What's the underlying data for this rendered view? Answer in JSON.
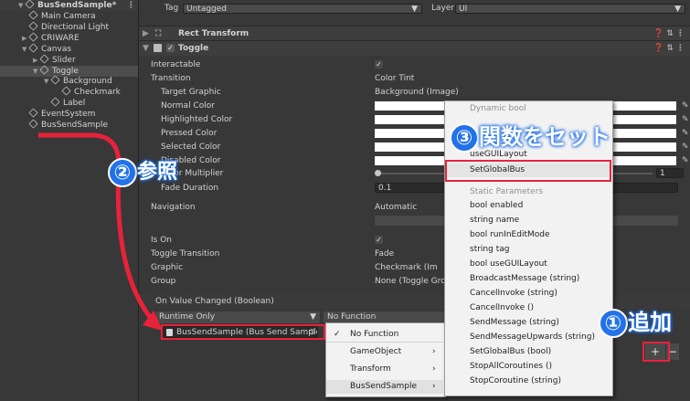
{
  "hierarchy": {
    "scene": "BusSendSample*",
    "items": [
      {
        "label": "Main Camera",
        "depth": 1,
        "arrow": ""
      },
      {
        "label": "Directional Light",
        "depth": 1,
        "arrow": ""
      },
      {
        "label": "CRIWARE",
        "depth": 1,
        "arrow": "▶"
      },
      {
        "label": "Canvas",
        "depth": 1,
        "arrow": "▼"
      },
      {
        "label": "Slider",
        "depth": 2,
        "arrow": "▶"
      },
      {
        "label": "Toggle",
        "depth": 2,
        "arrow": "▼"
      },
      {
        "label": "Background",
        "depth": 3,
        "arrow": "▼"
      },
      {
        "label": "Checkmark",
        "depth": 4,
        "arrow": ""
      },
      {
        "label": "Label",
        "depth": 3,
        "arrow": ""
      },
      {
        "label": "EventSystem",
        "depth": 1,
        "arrow": ""
      },
      {
        "label": "BusSendSample",
        "depth": 1,
        "arrow": ""
      }
    ]
  },
  "inspector": {
    "tag_label": "Tag",
    "tag_value": "Untagged",
    "layer_label": "Layer",
    "layer_value": "UI",
    "rect_transform": "Rect Transform",
    "toggle_header": "Toggle",
    "rows": [
      {
        "label": "Interactable",
        "kind": "check",
        "value": "✓"
      },
      {
        "label": "Transition",
        "kind": "text",
        "value": "Color Tint"
      },
      {
        "label": "Target Graphic",
        "kind": "text",
        "value": "Background (Image)",
        "indent": true
      },
      {
        "label": "Normal Color",
        "kind": "color",
        "indent": true
      },
      {
        "label": "Highlighted Color",
        "kind": "color",
        "indent": true
      },
      {
        "label": "Pressed Color",
        "kind": "color",
        "indent": true
      },
      {
        "label": "Selected Color",
        "kind": "color",
        "indent": true
      },
      {
        "label": "Disabled Color",
        "kind": "color",
        "indent": true
      },
      {
        "label": "Color Multiplier",
        "kind": "slider",
        "value": "1",
        "indent": true
      },
      {
        "label": "Fade Duration",
        "kind": "field",
        "value": "0.1",
        "indent": true
      },
      {
        "label": "Navigation",
        "kind": "text",
        "value": "Automatic"
      },
      {
        "label": "Is On",
        "kind": "check",
        "value": "✓"
      },
      {
        "label": "Toggle Transition",
        "kind": "text",
        "value": "Fade"
      },
      {
        "label": "Graphic",
        "kind": "text",
        "value": "Checkmark (Im"
      },
      {
        "label": "Group",
        "kind": "text",
        "value": "None (Toggle Gro"
      }
    ],
    "event_header": "On Value Changed (Boolean)",
    "runtime": "Runtime Only",
    "no_function": "No Function",
    "object_ref": "BusSendSample (Bus Send Sample"
  },
  "context_menu": {
    "items": [
      "No Function",
      "GameObject",
      "Transform",
      "BusSendSample"
    ],
    "checked": "No Function"
  },
  "function_menu": {
    "dynamic_header": "Dynamic bool",
    "dynamic_items": [
      "useGUILayout",
      "SetGlobalBus"
    ],
    "static_header": "Static Parameters",
    "static_items": [
      "bool enabled",
      "string name",
      "bool runInEditMode",
      "string tag",
      "bool useGUILayout",
      "BroadcastMessage (string)",
      "CancelInvoke (string)",
      "CancelInvoke ()",
      "SendMessage (string)",
      "SendMessageUpwards (string)",
      "SetGlobalBus (bool)",
      "StopAllCoroutines ()",
      "StopCoroutine (string)"
    ]
  },
  "annotations": {
    "step1": "追加",
    "step1_num": "①",
    "step2": "参照",
    "step2_num": "②",
    "step3": "関数をセット",
    "step3_num": "③"
  },
  "buttons": {
    "add": "+",
    "remove": "−"
  },
  "colors": {
    "accent": "#2272e8",
    "highlight": "#e8223a",
    "panel": "#383838"
  }
}
